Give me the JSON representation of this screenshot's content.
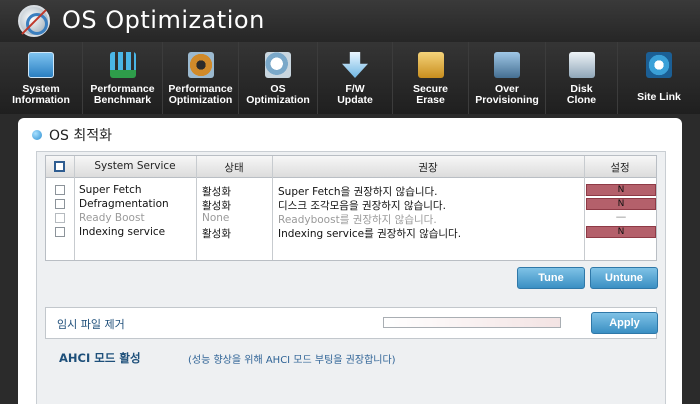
{
  "app": {
    "title": "OS Optimization"
  },
  "toolbar": {
    "items": [
      {
        "label": "System\nInformation",
        "icon": "system-info-icon"
      },
      {
        "label": "Performance\nBenchmark",
        "icon": "benchmark-icon"
      },
      {
        "label": "Performance\nOptimization",
        "icon": "gear-icon"
      },
      {
        "label": "OS\nOptimization",
        "icon": "os-optimization-icon"
      },
      {
        "label": "F/W\nUpdate",
        "icon": "firmware-update-icon"
      },
      {
        "label": "Secure\nErase",
        "icon": "lock-icon"
      },
      {
        "label": "Over\nProvisioning",
        "icon": "database-icon"
      },
      {
        "label": "Disk\nClone",
        "icon": "disk-clone-icon"
      },
      {
        "label": "Site Link",
        "icon": "globe-icon"
      }
    ]
  },
  "panel": {
    "title": "OS 최적화"
  },
  "table": {
    "headers": {
      "service": "System Service",
      "status": "상태",
      "recommendation": "권장",
      "setting": "설정"
    },
    "rows": [
      {
        "service": "Super Fetch",
        "status": "활성화",
        "recommendation": "Super Fetch을 권장하지 않습니다.",
        "setting": "N",
        "enabled": true
      },
      {
        "service": "Defragmentation",
        "status": "활성화",
        "recommendation": "디스크 조각모음을 권장하지 않습니다.",
        "setting": "N",
        "enabled": true
      },
      {
        "service": "Ready Boost",
        "status": "None",
        "recommendation": "Readyboost를 권장하지 않습니다.",
        "setting": "—",
        "enabled": false
      },
      {
        "service": "Indexing service",
        "status": "활성화",
        "recommendation": "Indexing service를 권장하지 않습니다.",
        "setting": "N",
        "enabled": true
      }
    ]
  },
  "buttons": {
    "tune": "Tune",
    "untune": "Untune",
    "apply": "Apply"
  },
  "temp": {
    "label": "임시 파일 제거",
    "progress": 0
  },
  "ahci": {
    "title": "AHCI 모드 활성",
    "description": "(성능 향상을 위해 AHCI 모드 부팅을 권장합니다)"
  },
  "colors": {
    "accent": "#3a8fc3",
    "setting_off": "#b4606b",
    "toolbar_bg": "#262626"
  }
}
